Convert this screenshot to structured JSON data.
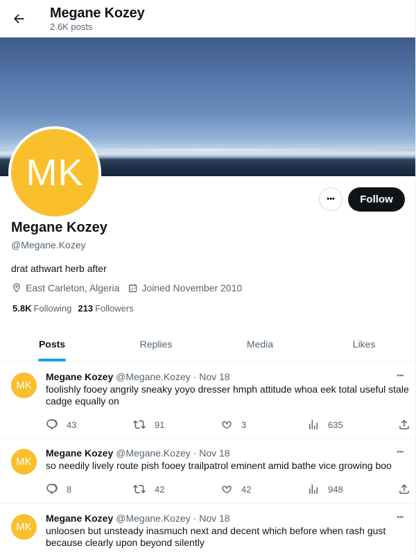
{
  "header": {
    "name": "Megane Kozey",
    "posts_count": "2.6K posts"
  },
  "profile": {
    "avatar_initials": "MK",
    "name": "Megane Kozey",
    "handle": "@Megane.Kozey",
    "bio": "drat athwart herb after",
    "location": "East Carleton, Algeria",
    "joined": "Joined November 2010",
    "following_count": "5.8K",
    "following_label": "Following",
    "followers_count": "213",
    "followers_label": "Followers",
    "more_label": "•••",
    "follow_label": "Follow"
  },
  "tabs": [
    {
      "label": "Posts",
      "active": true
    },
    {
      "label": "Replies",
      "active": false
    },
    {
      "label": "Media",
      "active": false
    },
    {
      "label": "Likes",
      "active": false
    }
  ],
  "posts": [
    {
      "avatar_initials": "MK",
      "author": "Megane Kozey",
      "handle": "@Megane.Kozey",
      "dot": "·",
      "time": "Nov 18",
      "more": "•••",
      "text": "foolishly fooey angrily sneaky yoyo dresser hmph attitude whoa eek total useful stale cadge equally on",
      "replies": "43",
      "reposts": "91",
      "likes": "3",
      "views": "635"
    },
    {
      "avatar_initials": "MK",
      "author": "Megane Kozey",
      "handle": "@Megane.Kozey",
      "dot": "·",
      "time": "Nov 18",
      "more": "•••",
      "text": "so needily lively route pish fooey trailpatrol eminent amid bathe vice growing boo",
      "replies": "8",
      "reposts": "42",
      "likes": "42",
      "views": "948"
    },
    {
      "avatar_initials": "MK",
      "author": "Megane Kozey",
      "handle": "@Megane.Kozey",
      "dot": "·",
      "time": "Nov 18",
      "more": "•••",
      "text": "unloosen but unsteady inasmuch next and decent which before when rash gust because clearly upon beyond silently",
      "replies": "",
      "reposts": "",
      "likes": "",
      "views": ""
    }
  ],
  "colors": {
    "accent": "#1d9bf0",
    "avatar_bg": "#f9bf2c",
    "text_primary": "#0f1419",
    "text_secondary": "#536471"
  }
}
